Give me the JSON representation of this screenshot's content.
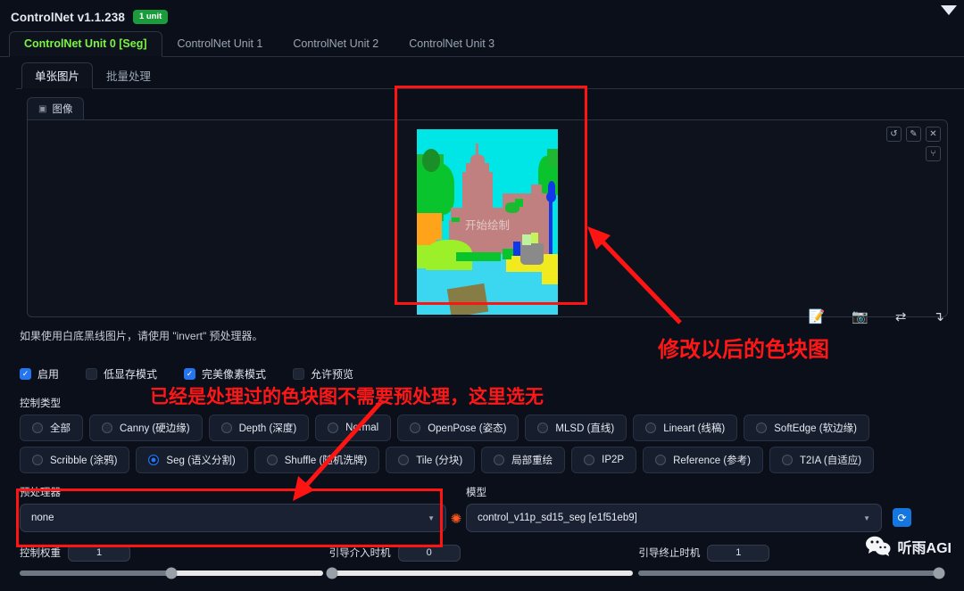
{
  "header": {
    "title": "ControlNet v1.1.238",
    "badge": "1 unit",
    "collapse_icon": "chevron-down-icon"
  },
  "unit_tabs": [
    {
      "label": "ControlNet Unit 0 [Seg]",
      "active": true
    },
    {
      "label": "ControlNet Unit 1",
      "active": false
    },
    {
      "label": "ControlNet Unit 2",
      "active": false
    },
    {
      "label": "ControlNet Unit 3",
      "active": false
    }
  ],
  "inner_tabs": [
    {
      "label": "单张图片",
      "active": true
    },
    {
      "label": "批量处理",
      "active": false
    }
  ],
  "image_panel": {
    "tab_label": "图像",
    "tab_icon": "image-icon",
    "draw_hint": "开始绘制",
    "icons": [
      "undo-icon",
      "eraser-icon",
      "close-icon",
      "brush-icon"
    ]
  },
  "hint_text": "如果使用白底黑线图片，请使用 \"invert\" 预处理器。",
  "tool_icons": [
    "edit-note-icon",
    "camera-icon",
    "swap-icon",
    "return-icon"
  ],
  "checkboxes": [
    {
      "label": "启用",
      "checked": true
    },
    {
      "label": "低显存模式",
      "checked": false
    },
    {
      "label": "完美像素模式",
      "checked": true
    },
    {
      "label": "允许预览",
      "checked": false
    }
  ],
  "control_type": {
    "label": "控制类型",
    "options": [
      {
        "label": "全部",
        "selected": false
      },
      {
        "label": "Canny (硬边缘)",
        "selected": false
      },
      {
        "label": "Depth (深度)",
        "selected": false
      },
      {
        "label": "Normal",
        "selected": false
      },
      {
        "label": "OpenPose (姿态)",
        "selected": false
      },
      {
        "label": "MLSD (直线)",
        "selected": false
      },
      {
        "label": "Lineart (线稿)",
        "selected": false
      },
      {
        "label": "SoftEdge (软边缘)",
        "selected": false
      },
      {
        "label": "Scribble (涂鸦)",
        "selected": false
      },
      {
        "label": "Seg (语义分割)",
        "selected": true
      },
      {
        "label": "Shuffle (随机洗牌)",
        "selected": false
      },
      {
        "label": "Tile (分块)",
        "selected": false
      },
      {
        "label": "局部重绘",
        "selected": false
      },
      {
        "label": "IP2P",
        "selected": false
      },
      {
        "label": "Reference (参考)",
        "selected": false
      },
      {
        "label": "T2IA (自适应)",
        "selected": false
      }
    ]
  },
  "preprocessor": {
    "label": "预处理器",
    "value": "none",
    "spark_icon": "explosion-icon"
  },
  "model": {
    "label": "模型",
    "value": "control_v11p_sd15_seg [e1f51eb9]",
    "refresh_icon": "refresh-icon"
  },
  "sliders": [
    {
      "label": "控制权重",
      "value": "1",
      "fill": 0.5
    },
    {
      "label": "引导介入时机",
      "value": "0",
      "fill": 0.0
    },
    {
      "label": "引导终止时机",
      "value": "1",
      "fill": 1.0
    }
  ],
  "annotations": [
    {
      "id": "anno-image",
      "text": "修改以后的色块图"
    },
    {
      "id": "anno-preproc",
      "text": "已经是处理过的色块图不需要预处理，这里选无"
    }
  ],
  "watermark": {
    "text": "听雨AGI",
    "icon": "wechat-icon"
  },
  "colors": {
    "accent_green": "#7bf542",
    "badge_green": "#1a9c3c",
    "annotation_red": "#ff1717",
    "radio_blue": "#2575f0",
    "refresh_blue": "#1576e0"
  }
}
